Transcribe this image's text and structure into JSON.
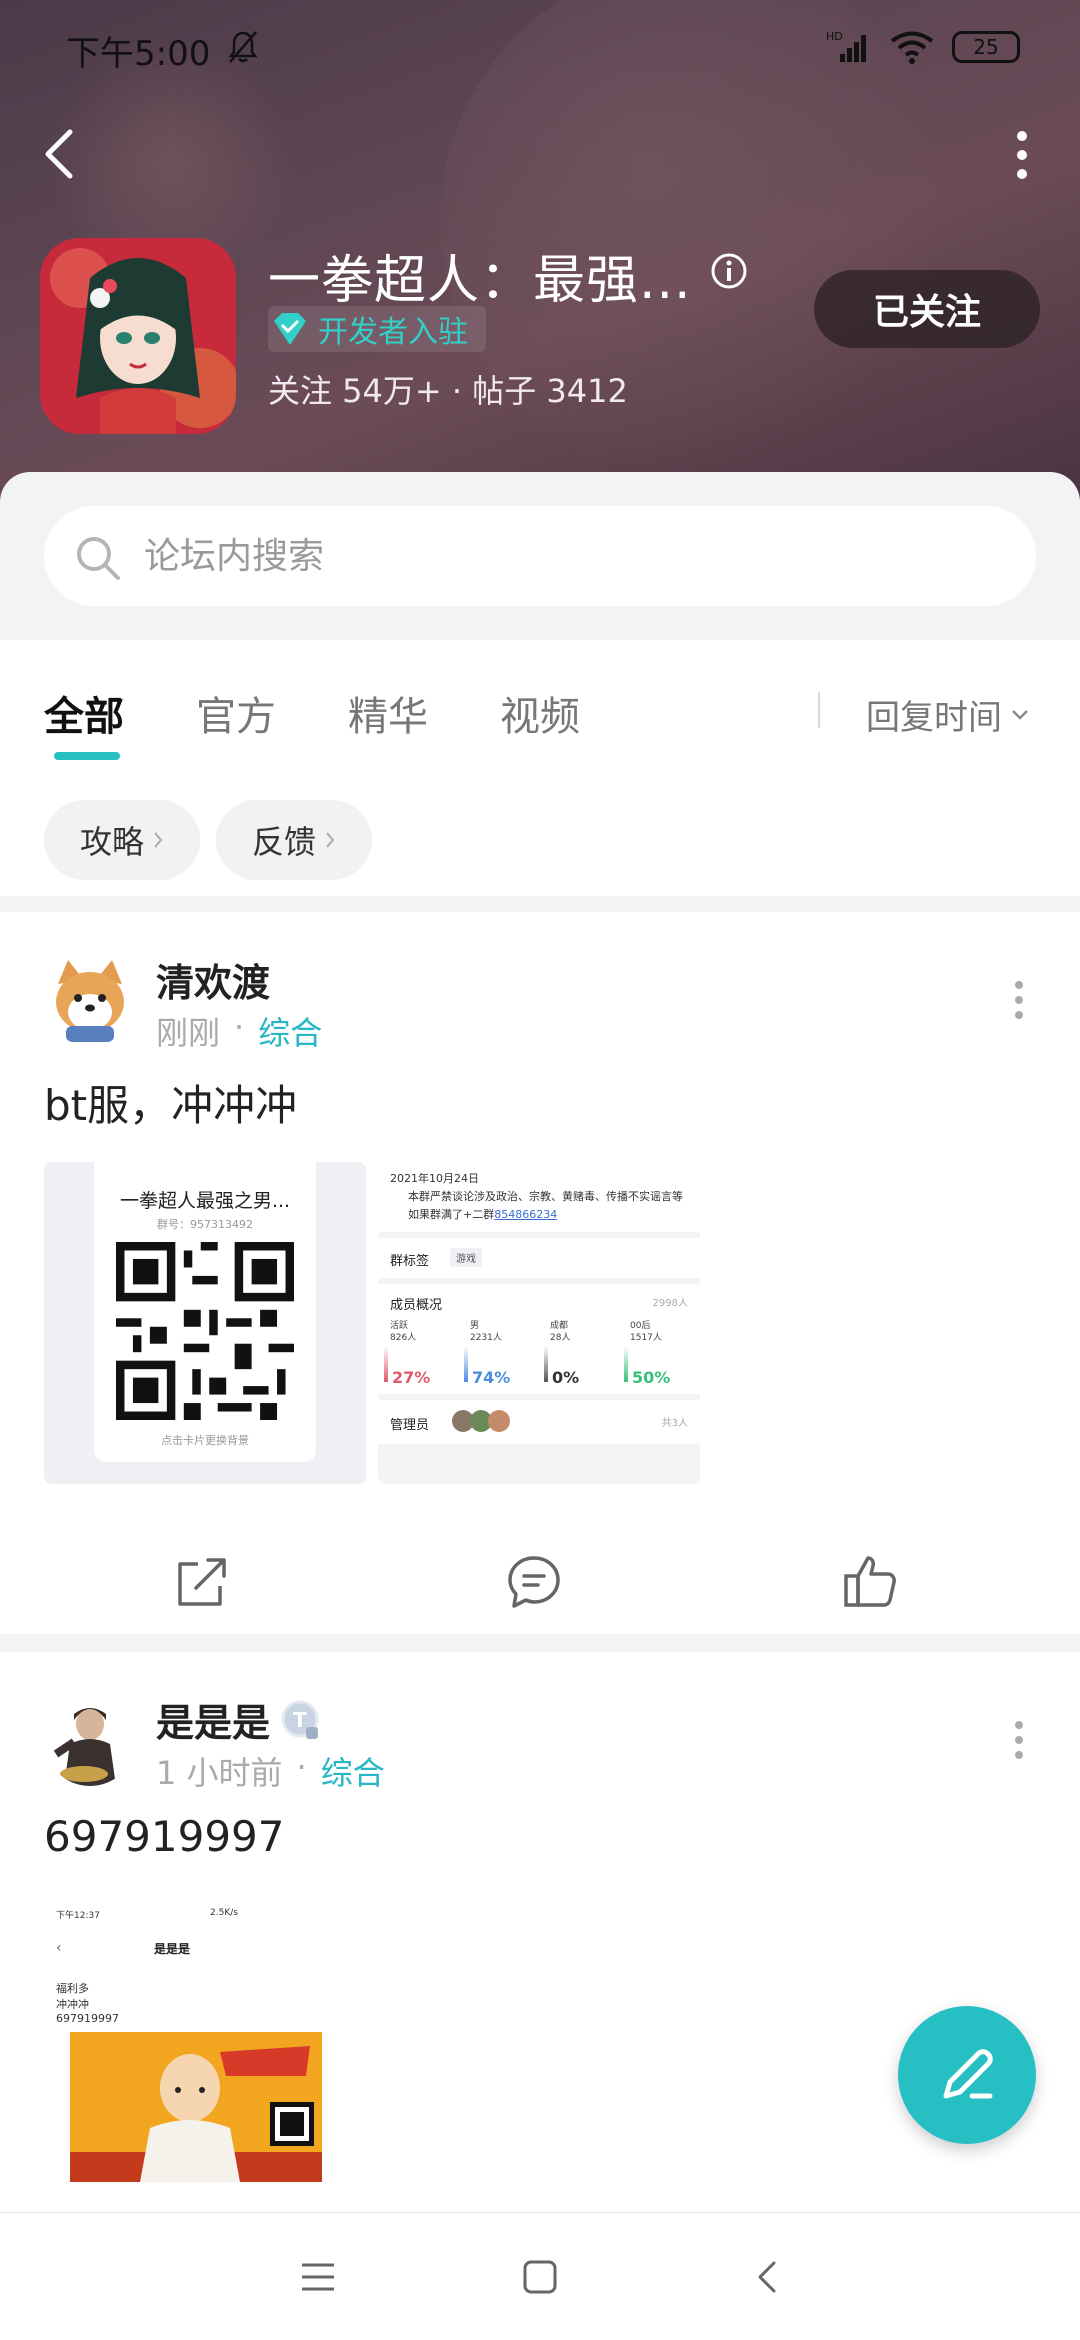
{
  "status_bar": {
    "time": "下午5:00",
    "signal": "HD",
    "battery": "25"
  },
  "header": {
    "app_title": "一拳超人：最强...",
    "developer_badge": "开发者入驻",
    "stats": "关注 54万+ · 帖子 3412",
    "follow_button": "已关注"
  },
  "search": {
    "placeholder": "论坛内搜索"
  },
  "tabs": [
    {
      "label": "全部",
      "active": true
    },
    {
      "label": "官方",
      "active": false
    },
    {
      "label": "精华",
      "active": false
    },
    {
      "label": "视频",
      "active": false
    }
  ],
  "sort": {
    "label": "回复时间"
  },
  "chips": [
    {
      "label": "攻略"
    },
    {
      "label": "反馈"
    }
  ],
  "posts": [
    {
      "author": "清欢渡",
      "time": "刚刚",
      "category": "综合",
      "text": "bt服，冲冲冲",
      "image1": {
        "title": "一拳超人最强之男...",
        "group_no": "群号：957313492",
        "hint": "点击卡片更换背景"
      },
      "image2": {
        "date": "2021年10月24日",
        "notice": "本群严禁谈论涉及政治、宗教、黄赌毒、传播不实谣言等",
        "notice2": "如果群满了+二群",
        "group2": "854866234",
        "tag_label": "群标签",
        "tag": "游戏",
        "members_label": "成员概况",
        "members_count": "2998人",
        "stat_active": "活跃",
        "stat_active_n": "826人",
        "stat_male": "男",
        "stat_male_n": "2231人",
        "stat_adult": "成都",
        "stat_adult_n": "28人",
        "stat_00": "00后",
        "stat_00_n": "1517人",
        "pct1": "27%",
        "pct2": "74%",
        "pct3": "0%",
        "pct4": "50%",
        "admins_label": "管理员",
        "admins_count": "共3人"
      }
    },
    {
      "author": "是是是",
      "time": "1 小时前",
      "category": "综合",
      "text": "697919997",
      "image1": {
        "status_time": "下午12:37",
        "status_right": "2.5K/s",
        "chat_title": "是是是",
        "line1": "福利多",
        "line2": "冲冲冲",
        "line3": "697919997"
      }
    }
  ],
  "colors": {
    "accent": "#26c0c2",
    "header_bg": "#5a4250",
    "category": "#27b7c4"
  }
}
